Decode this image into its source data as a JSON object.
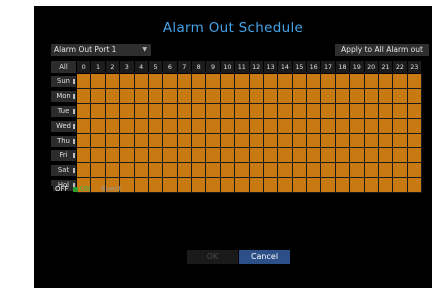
{
  "dialog": {
    "title": "Alarm Out Schedule",
    "port_select": {
      "value": "Alarm Out Port 1",
      "chevron_icon": "chevron-down-icon"
    },
    "apply_button": "Apply to All Alarm out"
  },
  "schedule": {
    "all_label": "All",
    "hours": [
      "0",
      "1",
      "2",
      "3",
      "4",
      "5",
      "6",
      "7",
      "8",
      "9",
      "10",
      "11",
      "12",
      "13",
      "14",
      "15",
      "16",
      "17",
      "18",
      "19",
      "20",
      "21",
      "22",
      "23"
    ],
    "days": [
      "Sun",
      "Mon",
      "Tue",
      "Wed",
      "Thu",
      "Fri",
      "Sat",
      "Hol"
    ],
    "cell_state": "Event",
    "colors": {
      "off": "#000000",
      "on": "#2e9e2e",
      "event": "#c87912"
    }
  },
  "legend": {
    "off": "OFF",
    "on": "ON",
    "event": "Event"
  },
  "buttons": {
    "ok": "OK",
    "cancel": "Cancel"
  }
}
